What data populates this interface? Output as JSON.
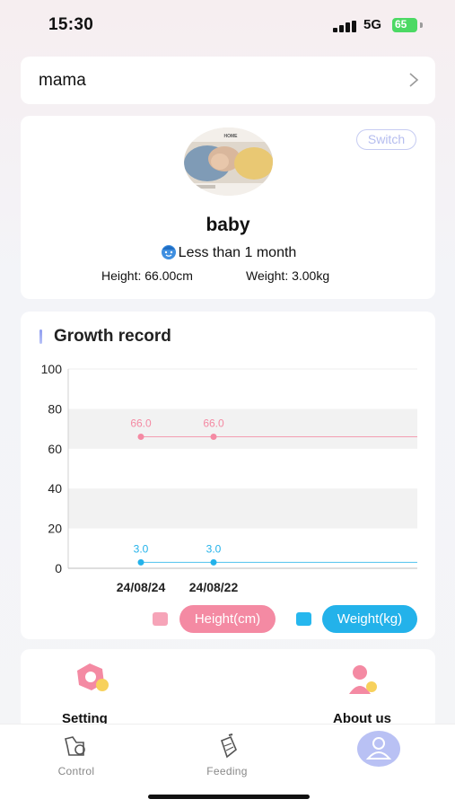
{
  "status_bar": {
    "time": "15:30",
    "network": "5G",
    "battery": "65"
  },
  "profile": {
    "name": "mama"
  },
  "baby": {
    "avatar_caption": "HOME",
    "switch_label": "Switch",
    "name": "baby",
    "age": "Less than 1 month",
    "height_text": "Height: 66.00cm",
    "weight_text": "Weight: 3.00kg"
  },
  "growth": {
    "title": "Growth record",
    "legend": {
      "height": "Height(cm)",
      "weight": "Weight(kg)"
    }
  },
  "chart_data": {
    "type": "line",
    "x": [
      "24/08/24",
      "24/08/22"
    ],
    "series": [
      {
        "name": "Height(cm)",
        "values": [
          66.0,
          66.0
        ],
        "labels": [
          "66.0",
          "66.0"
        ],
        "color": "#f48aa3"
      },
      {
        "name": "Weight(kg)",
        "values": [
          3.0,
          3.0
        ],
        "labels": [
          "3.0",
          "3.0"
        ],
        "color": "#23b2ea"
      }
    ],
    "ylim": [
      0,
      100
    ],
    "yticks": [
      0,
      20,
      40,
      60,
      80,
      100
    ],
    "legend": "bottom-right",
    "grid": "alternating bands"
  },
  "shortcuts": {
    "setting": "Setting",
    "about": "About us"
  },
  "tabs": {
    "control": "Control",
    "feeding": "Feeding",
    "mine": "Mine"
  },
  "colors": {
    "accent": "#b9c1f4",
    "height": "#f48aa3",
    "weight": "#23b2ea"
  }
}
